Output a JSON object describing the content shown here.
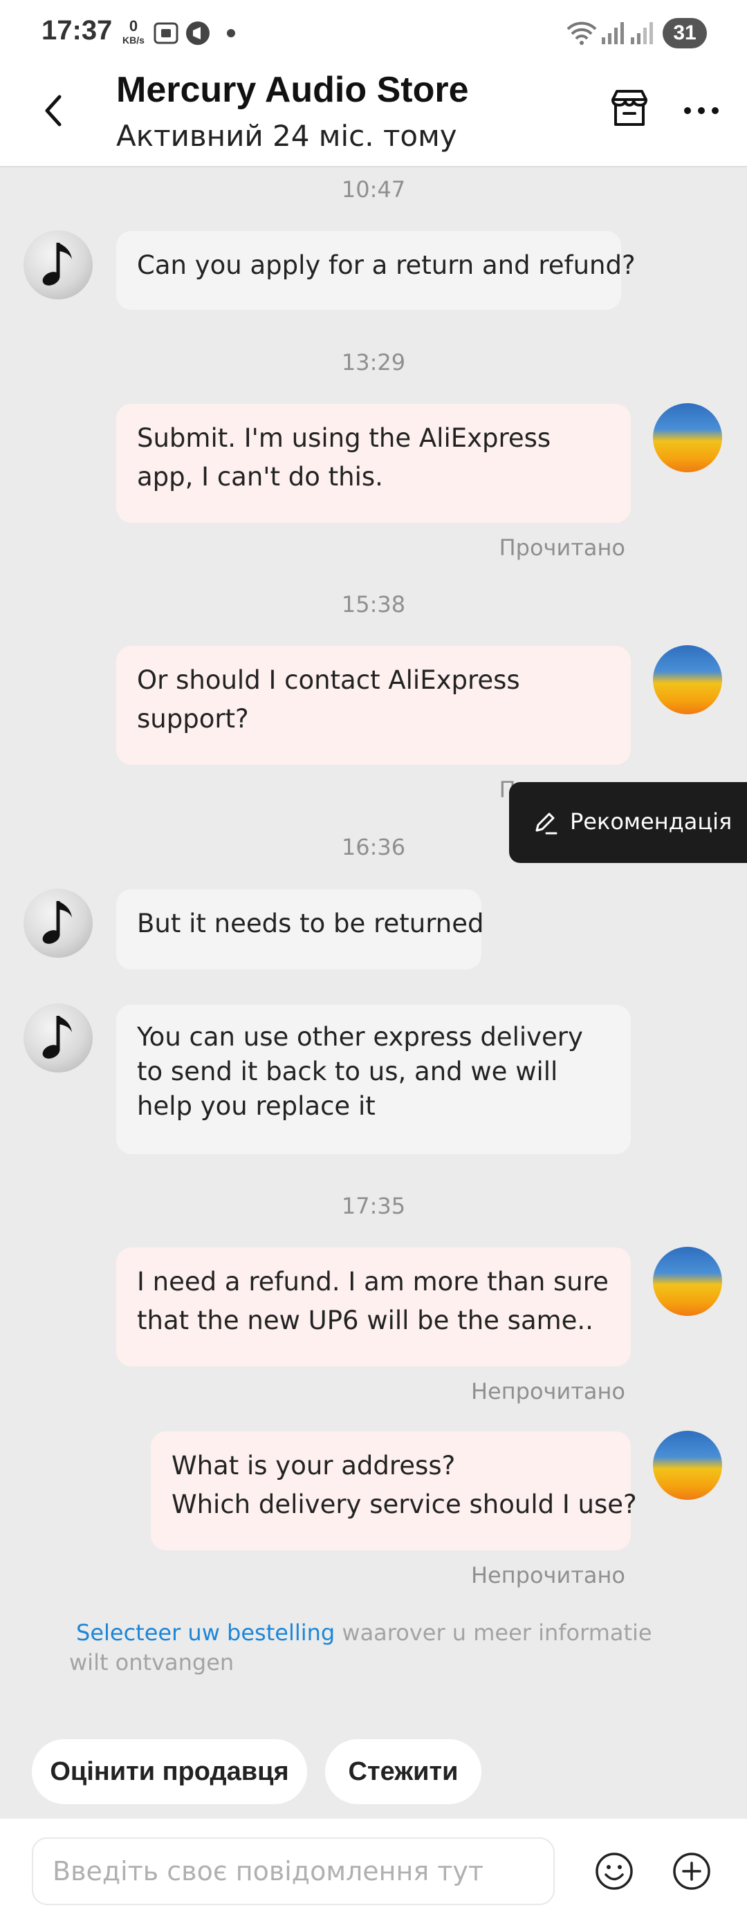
{
  "status_bar": {
    "time": "17:37",
    "net_speed": "0",
    "net_unit": "KB/s",
    "battery": "31"
  },
  "header": {
    "title": "Mercury Audio Store",
    "subtitle": "Активний 24 міс. тому"
  },
  "messages": {
    "t1": "10:47",
    "m1": "Can you apply for a return and refund?",
    "t2": "13:29",
    "m2": "Submit. I'm using the AliExpress app, I can't do this.",
    "s2": "Прочитано",
    "t3": "15:38",
    "m3": "Or should I contact AliExpress support?",
    "s3": "Прочитано",
    "t4": "16:36",
    "m4": "But it needs to be returned",
    "m5": "You can use other express delivery to send it back to us, and we will help you replace it",
    "t5": "17:35",
    "m6": "I need a refund. I am more than sure that the new UP6 will be the same..",
    "s6": "Непрочитано",
    "m7_line1": "What is your address?",
    "m7_line2": "Which delivery service should I use?",
    "s7": "Непрочитано"
  },
  "recommendation": {
    "label": "Рекомендація"
  },
  "order_hint": {
    "link": "Selecteer uw bestelling",
    "text": "waarover u meer informatie wilt ontvangen"
  },
  "quick_actions": {
    "rate_seller": "Оцінити продавця",
    "follow": "Стежити"
  },
  "composer": {
    "placeholder": "Введіть своє повідомлення тут"
  },
  "colors": {
    "accent_link": "#1c86d8",
    "outgoing_bubble": "#fdf0ef",
    "incoming_bubble": "#f4f4f4"
  },
  "icons": [
    "back-arrow-icon",
    "store-icon",
    "more-icon",
    "pen-icon",
    "emoji-icon",
    "plus-icon",
    "music-note-icon"
  ]
}
